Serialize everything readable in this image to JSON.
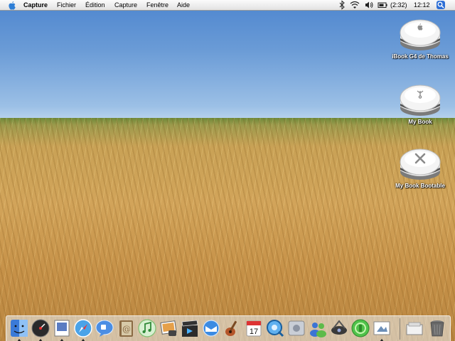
{
  "menubar": {
    "app_name": "Capture",
    "menus": [
      "Fichier",
      "Édition",
      "Capture",
      "Fenêtre",
      "Aide"
    ],
    "battery_time": "(2:32)",
    "clock": "12:12"
  },
  "desktop": {
    "icons": [
      {
        "label": "iBook G4 de Thomas",
        "icon": "internal-disk-apple-logo"
      },
      {
        "label": "My Book",
        "icon": "external-disk-firewire"
      },
      {
        "label": "My Book Bootable",
        "icon": "external-disk-osx"
      }
    ]
  },
  "dock": {
    "apps": [
      "finder-icon",
      "dashboard-icon",
      "preview-icon",
      "safari-icon",
      "ichat-icon",
      "address-book-icon",
      "itunes-icon",
      "iphoto-icon",
      "imovie-icon",
      "mail-icon",
      "garageband-icon",
      "ical-icon",
      "quicktime-icon",
      "system-preferences-icon",
      "users-icon",
      "network-icon",
      "dashcode-icon",
      "grab-icon"
    ],
    "trash": [
      "documents-icon",
      "trash-icon"
    ]
  }
}
